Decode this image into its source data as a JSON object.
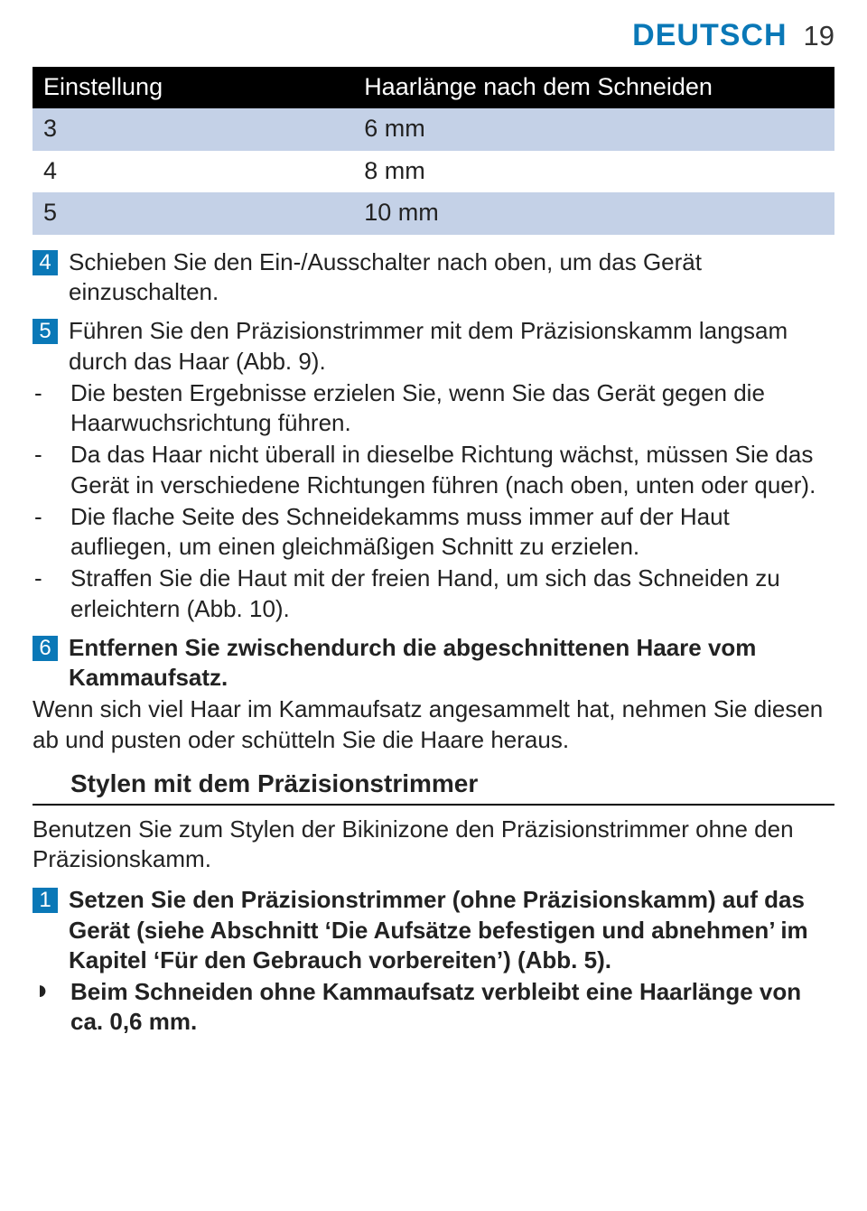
{
  "header": {
    "lang": "DEUTSCH",
    "page": "19"
  },
  "table": {
    "col1": "Einstellung",
    "col2": "Haarlänge nach dem Schneiden",
    "rows": [
      {
        "c1": "3",
        "c2": "6 mm"
      },
      {
        "c1": "4",
        "c2": "8 mm"
      },
      {
        "c1": "5",
        "c2": "10 mm"
      }
    ]
  },
  "step4": {
    "num": "4",
    "text": "Schieben Sie den Ein-/Ausschalter nach oben, um das Gerät einzuschalten."
  },
  "step5": {
    "num": "5",
    "text": "Führen Sie den Präzisionstrimmer mit dem Präzisionskamm langsam durch das Haar (Abb. 9)."
  },
  "bullets": [
    "Die besten Ergebnisse erzielen Sie, wenn Sie das Gerät gegen die Haarwuchsrichtung führen.",
    "Da das Haar nicht überall in dieselbe Richtung wächst, müssen Sie das Gerät in verschiedene Richtungen führen (nach oben, unten oder quer).",
    "Die flache Seite des Schneidekamms muss immer auf der Haut aufliegen, um einen gleichmäßigen Schnitt zu erzielen.",
    "Straffen Sie die Haut mit der freien Hand, um sich das Schneiden zu erleichtern (Abb. 10)."
  ],
  "step6": {
    "num": "6",
    "bold": "Entfernen Sie zwischendurch die abgeschnittenen Haare vom Kammaufsatz.",
    "after": "Wenn sich viel Haar im Kammaufsatz angesammelt hat, nehmen Sie diesen ab und pusten oder schütteln Sie die Haare heraus."
  },
  "subheading": "Stylen mit dem Präzisionstrimmer",
  "intro2": "Benutzen Sie zum Stylen der Bikinizone den Präzisionstrimmer ohne den Präzisionskamm.",
  "step1b": {
    "num": "1",
    "text": "Setzen Sie den Präzisionstrimmer (ohne Präzisionskamm) auf das Gerät (siehe Abschnitt ‘Die Aufsätze befestigen und abnehmen’ im Kapitel ‘Für den Gebrauch vorbereiten’) (Abb. 5)."
  },
  "note": "Beim Schneiden ohne Kammaufsatz verbleibt eine Haarlänge von ca. 0,6 mm."
}
